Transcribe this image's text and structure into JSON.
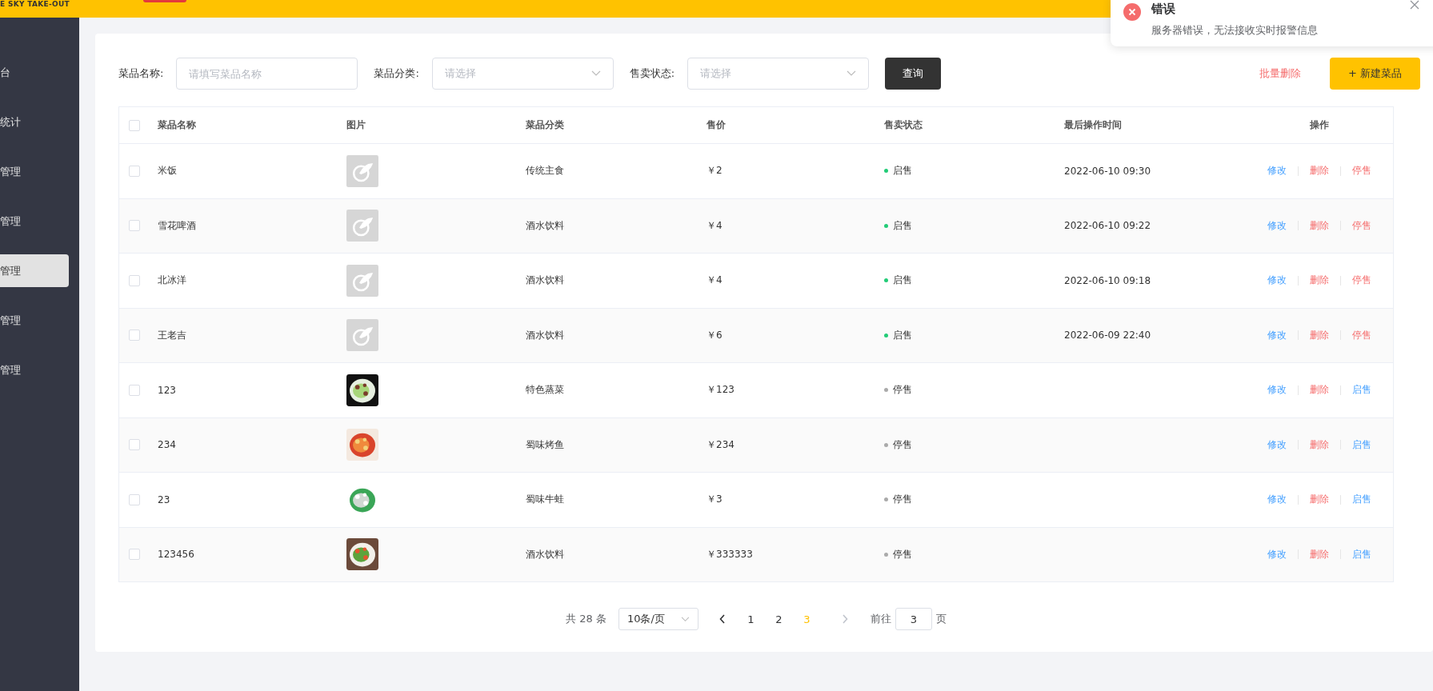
{
  "header": {
    "logo_text": "E SKY TAKE-OUT"
  },
  "sidebar": {
    "items": [
      {
        "label": "台",
        "selected": false
      },
      {
        "label": "统计",
        "selected": false
      },
      {
        "label": "管理",
        "selected": false
      },
      {
        "label": "管理",
        "selected": false
      },
      {
        "label": "管理",
        "selected": true
      },
      {
        "label": "管理",
        "selected": false
      },
      {
        "label": "管理",
        "selected": false
      }
    ]
  },
  "filters": {
    "name_label": "菜品名称:",
    "name_placeholder": "请填写菜品名称",
    "category_label": "菜品分类:",
    "category_placeholder": "请选择",
    "status_label": "售卖状态:",
    "status_placeholder": "请选择",
    "query_button": "查询",
    "batch_delete": "批量删除",
    "add_button": "+ 新建菜品"
  },
  "table": {
    "all_checked": false,
    "columns": [
      "菜品名称",
      "图片",
      "菜品分类",
      "售价",
      "售卖状态",
      "最后操作时间",
      "操作"
    ],
    "rows": [
      {
        "checked": false,
        "name": "米饭",
        "kind": "placeholder",
        "category": "传统主食",
        "price": "￥2",
        "status": "启售",
        "on_sale": true,
        "time": "2022-06-10 09:30",
        "edit": "修改",
        "delete": "删除",
        "toggle": "停售"
      },
      {
        "checked": false,
        "name": "雪花啤酒",
        "kind": "placeholder",
        "category": "酒水饮料",
        "price": "￥4",
        "status": "启售",
        "on_sale": true,
        "time": "2022-06-10 09:22",
        "edit": "修改",
        "delete": "删除",
        "toggle": "停售"
      },
      {
        "checked": false,
        "name": "北冰洋",
        "kind": "placeholder",
        "category": "酒水饮料",
        "price": "￥4",
        "status": "启售",
        "on_sale": true,
        "time": "2022-06-10 09:18",
        "edit": "修改",
        "delete": "删除",
        "toggle": "停售"
      },
      {
        "checked": false,
        "name": "王老吉",
        "kind": "placeholder",
        "category": "酒水饮料",
        "price": "￥6",
        "status": "启售",
        "on_sale": true,
        "time": "2022-06-09 22:40",
        "edit": "修改",
        "delete": "删除",
        "toggle": "停售"
      },
      {
        "checked": false,
        "name": "123",
        "kind": "picture",
        "category": "特色蒸菜",
        "price": "￥123",
        "status": "停售",
        "on_sale": false,
        "edit": "修改",
        "delete": "删除",
        "toggle": "启售"
      },
      {
        "checked": false,
        "name": "234",
        "kind": "picture",
        "category": "蜀味烤鱼",
        "price": "￥234",
        "status": "停售",
        "on_sale": false,
        "edit": "修改",
        "delete": "删除",
        "toggle": "启售"
      },
      {
        "checked": false,
        "name": "23",
        "kind": "picture",
        "category": "蜀味牛蛙",
        "price": "￥3",
        "status": "停售",
        "on_sale": false,
        "edit": "修改",
        "delete": "删除",
        "toggle": "启售"
      },
      {
        "checked": false,
        "name": "123456",
        "kind": "picture",
        "category": "酒水饮料",
        "price": "￥333333",
        "status": "停售",
        "on_sale": false,
        "edit": "修改",
        "delete": "删除",
        "toggle": "启售"
      }
    ]
  },
  "pagination": {
    "total": "共 28 条",
    "page_size": "10条/页",
    "prev_disabled": false,
    "next_disabled": true,
    "pages": [
      {
        "label": "1",
        "selected": false
      },
      {
        "label": "2",
        "selected": false
      },
      {
        "label": "3",
        "selected": true
      }
    ],
    "goto_label": "前往",
    "goto_value": "3",
    "goto_suffix": "页"
  },
  "notification": {
    "title": "错误",
    "message": "服务器错误，无法接收实时报警信息"
  }
}
